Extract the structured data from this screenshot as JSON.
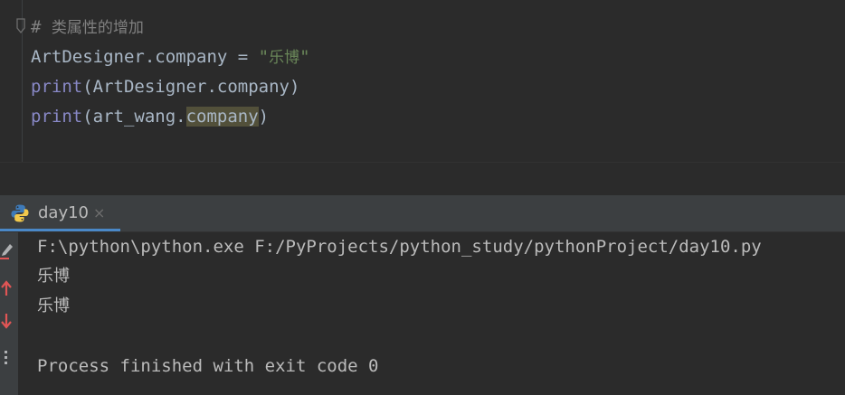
{
  "editor": {
    "comment": {
      "hash": "# ",
      "text": "类属性的增加"
    },
    "line2": {
      "target": "ArtDesigner.company = ",
      "string_open": "\"",
      "string_text": "乐博",
      "string_close": "\""
    },
    "line3": {
      "func": "print",
      "args": "(ArtDesigner.company)"
    },
    "line4": {
      "func": "print",
      "args_prefix": "(art_wang.",
      "highlighted": "company",
      "args_suffix": ")"
    }
  },
  "run_panel": {
    "tab_label": "day10",
    "tab_close_glyph": "×",
    "command": "F:\\python\\python.exe F:/PyProjects/python_study/pythonProject/day10.py",
    "output": [
      "乐博",
      "乐博"
    ],
    "exit_message": "Process finished with exit code 0"
  },
  "colors": {
    "background": "#2b2b2b",
    "comment": "#808080",
    "string": "#6a8759",
    "builtin": "#8888c6",
    "highlight": "#52503a",
    "tab_underline": "#4a88c7",
    "rerun_icon": "#e05555"
  }
}
